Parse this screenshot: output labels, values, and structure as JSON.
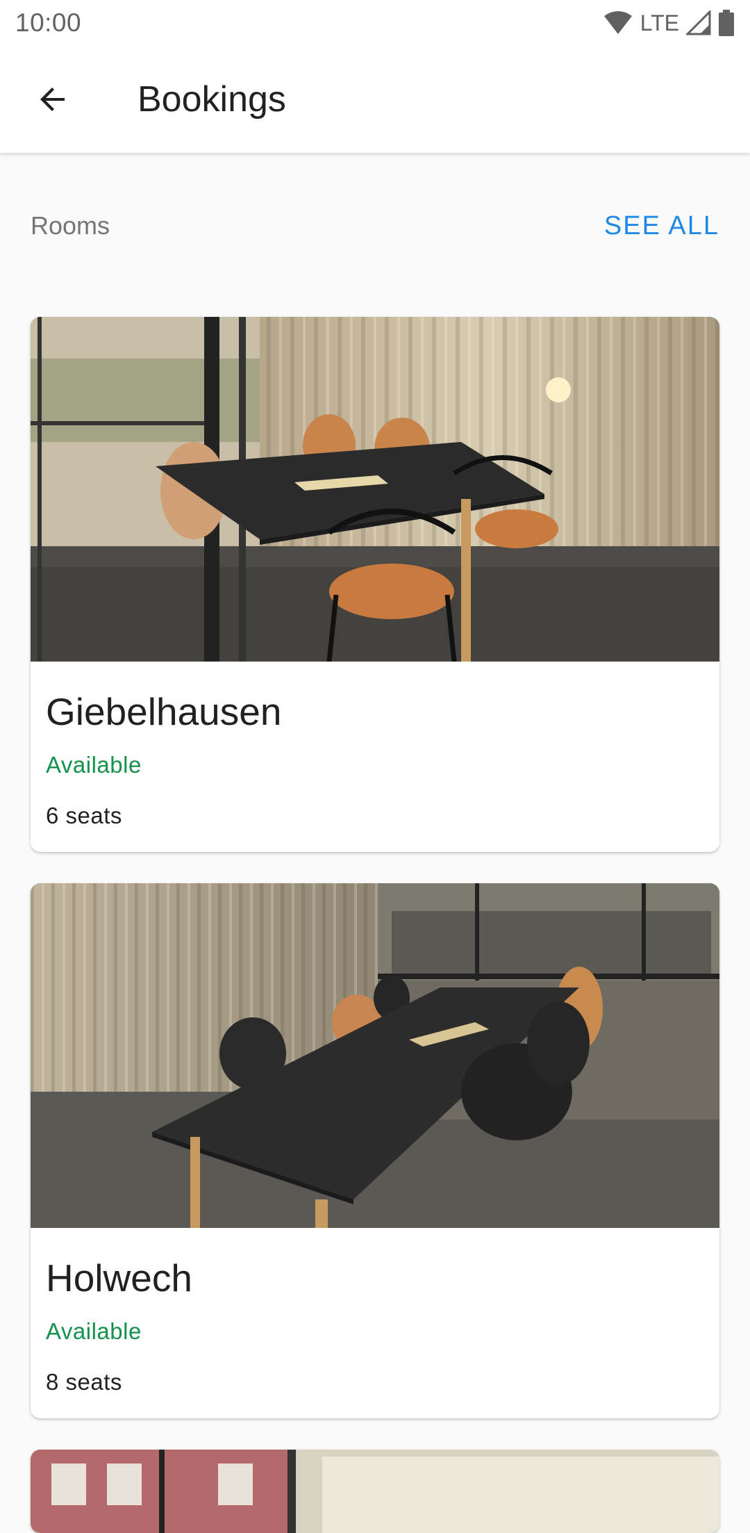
{
  "status_bar": {
    "time": "10:00",
    "network": "LTE",
    "icons": [
      "wifi-icon",
      "signal-icon",
      "battery-icon"
    ]
  },
  "app_bar": {
    "title": "Bookings",
    "back_icon": "arrow-back-icon"
  },
  "section": {
    "title": "Rooms",
    "see_all": "SEE ALL"
  },
  "rooms": [
    {
      "name": "Giebelhausen",
      "status": "Available",
      "seats": "6 seats"
    },
    {
      "name": "Holwech",
      "status": "Available",
      "seats": "8 seats"
    }
  ],
  "colors": {
    "accent": "#1e88e5",
    "available": "#12924a",
    "background": "#fafafa"
  }
}
